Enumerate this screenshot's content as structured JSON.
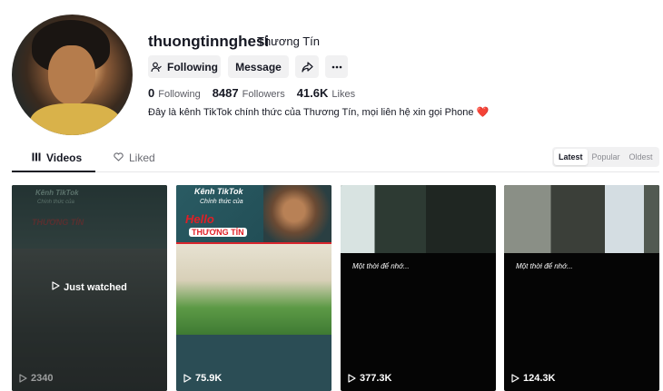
{
  "profile": {
    "username": "thuongtinnghesi",
    "nickname": "Thương Tín",
    "bio": "Đây là kênh TikTok chính thức của Thương Tín, mọi liên hệ xin gọi Phone",
    "bio_emoji": "❤️"
  },
  "actions": {
    "following_label": "Following",
    "message_label": "Message",
    "share_icon": "share-icon",
    "more_icon": "more-icon"
  },
  "stats": [
    {
      "value": "0",
      "label": "Following"
    },
    {
      "value": "8487",
      "label": "Followers"
    },
    {
      "value": "41.6K",
      "label": "Likes"
    }
  ],
  "tabs": [
    {
      "label": "Videos",
      "icon": "grid-icon",
      "active": true
    },
    {
      "label": "Liked",
      "icon": "heart-outline-icon",
      "active": false
    }
  ],
  "sort": {
    "options": [
      "Latest",
      "Popular",
      "Oldest"
    ],
    "selected": "Latest"
  },
  "videos": [
    {
      "views": "2340",
      "watched_label": "Just watched",
      "title_lines": [
        "Kênh TikTok",
        "Chính thức của"
      ],
      "logo": "THƯƠNG TÍN"
    },
    {
      "views": "75.9K",
      "title_lines": [
        "Kênh TikTok",
        "Chính thức của"
      ],
      "logo": "Hello",
      "brand": "THƯƠNG TÍN"
    },
    {
      "views": "377.3K",
      "caption": "Một thời để nhớ..."
    },
    {
      "views": "124.3K",
      "caption": "Một thời để nhớ..."
    }
  ],
  "colors": {
    "text_primary": "#161823",
    "text_secondary": "#5a5b63",
    "button_bg": "#f1f1f2",
    "accent_red": "#e0323c"
  }
}
